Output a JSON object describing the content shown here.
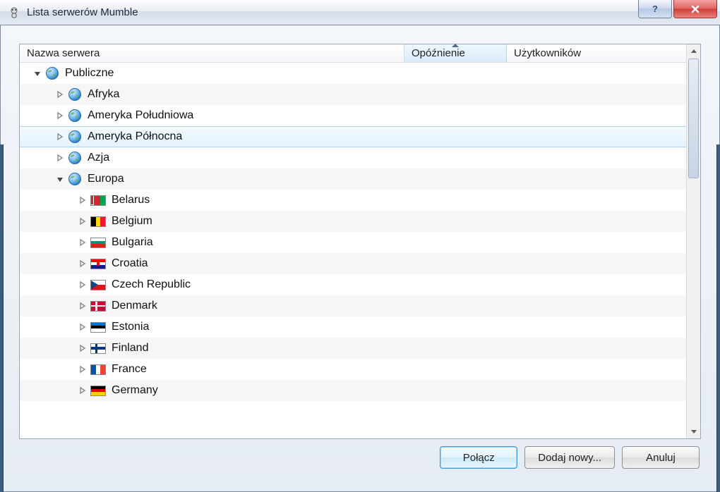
{
  "window": {
    "title": "Lista serwerów Mumble"
  },
  "columns": {
    "name": "Nazwa serwera",
    "delay": "Opóźnienie",
    "users": "Użytkowników"
  },
  "tree": [
    {
      "level": 0,
      "expanded": true,
      "icon": "globe",
      "label": "Publiczne"
    },
    {
      "level": 1,
      "expanded": false,
      "icon": "globe",
      "label": "Afryka"
    },
    {
      "level": 1,
      "expanded": false,
      "icon": "globe",
      "label": "Ameryka Południowa"
    },
    {
      "level": 1,
      "expanded": false,
      "icon": "globe",
      "label": "Ameryka Północna",
      "selected": true
    },
    {
      "level": 1,
      "expanded": false,
      "icon": "globe",
      "label": "Azja"
    },
    {
      "level": 1,
      "expanded": true,
      "icon": "globe",
      "label": "Europa"
    },
    {
      "level": 2,
      "expanded": false,
      "icon": "flag-by",
      "label": "Belarus"
    },
    {
      "level": 2,
      "expanded": false,
      "icon": "flag-be",
      "label": "Belgium"
    },
    {
      "level": 2,
      "expanded": false,
      "icon": "flag-bg",
      "label": "Bulgaria"
    },
    {
      "level": 2,
      "expanded": false,
      "icon": "flag-hr",
      "label": "Croatia"
    },
    {
      "level": 2,
      "expanded": false,
      "icon": "flag-cz",
      "label": "Czech Republic"
    },
    {
      "level": 2,
      "expanded": false,
      "icon": "flag-dk",
      "label": "Denmark"
    },
    {
      "level": 2,
      "expanded": false,
      "icon": "flag-ee",
      "label": "Estonia"
    },
    {
      "level": 2,
      "expanded": false,
      "icon": "flag-fi",
      "label": "Finland"
    },
    {
      "level": 2,
      "expanded": false,
      "icon": "flag-fr",
      "label": "France"
    },
    {
      "level": 2,
      "expanded": false,
      "icon": "flag-de",
      "label": "Germany"
    }
  ],
  "buttons": {
    "connect": "Połącz",
    "add": "Dodaj nowy...",
    "cancel": "Anuluj"
  }
}
